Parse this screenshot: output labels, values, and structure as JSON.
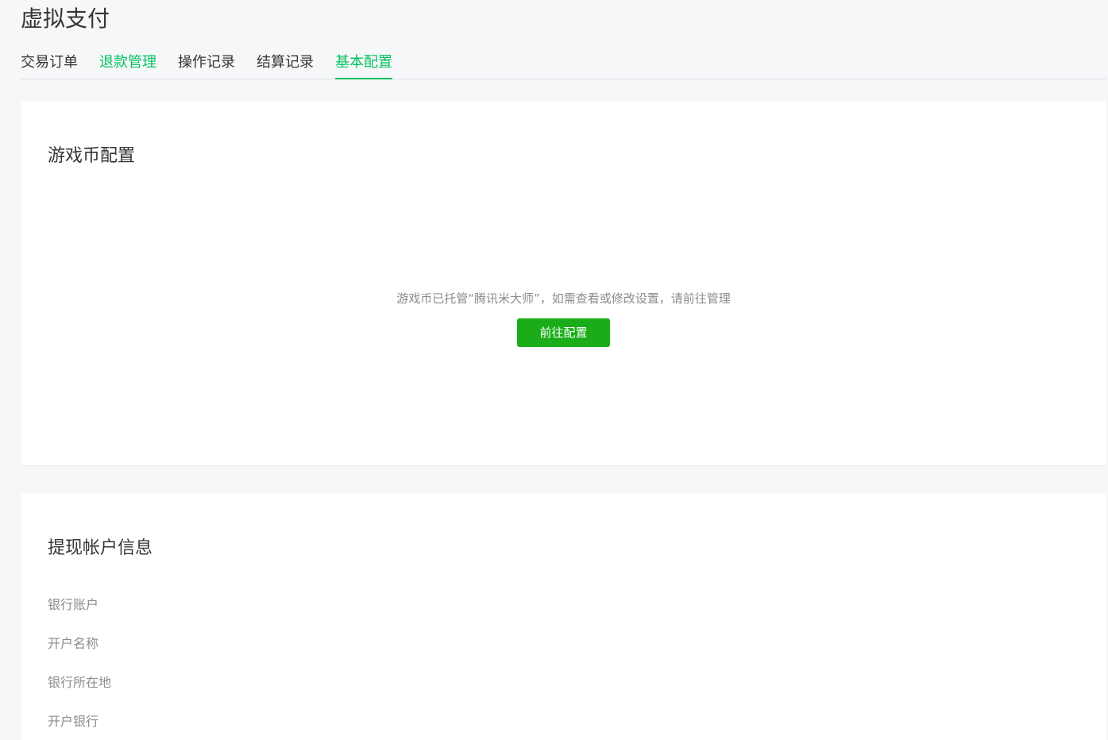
{
  "page": {
    "title": "虚拟支付"
  },
  "tabs": [
    {
      "label": "交易订单",
      "state": "normal"
    },
    {
      "label": "退款管理",
      "state": "highlighted"
    },
    {
      "label": "操作记录",
      "state": "normal"
    },
    {
      "label": "结算记录",
      "state": "normal"
    },
    {
      "label": "基本配置",
      "state": "active"
    }
  ],
  "game_coin_section": {
    "title": "游戏币配置",
    "notice": "游戏币已托管“腾讯米大师”，如需查看或修改设置，请前往管理",
    "button_label": "前往配置"
  },
  "withdraw_section": {
    "title": "提现帐户信息",
    "fields": [
      {
        "label": "银行账户"
      },
      {
        "label": "开户名称"
      },
      {
        "label": "银行所在地"
      },
      {
        "label": "开户银行"
      }
    ]
  },
  "colors": {
    "accent": "#07c160",
    "button": "#1aad19",
    "background": "#f6f7f9",
    "muted_text": "#8c8c8c"
  }
}
